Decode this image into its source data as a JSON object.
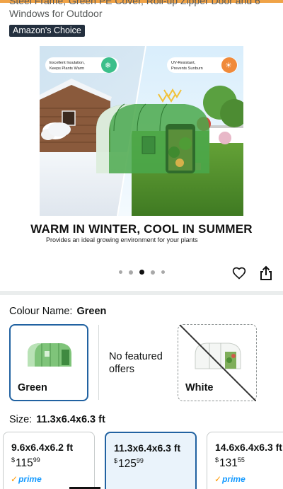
{
  "product": {
    "title_tail": "Steel Frame, Green PE Cover, Roll-up Zipper Door and 6 Windows for Outdoor",
    "badge": "Amazon's Choice"
  },
  "hero": {
    "callout_left": "Excellent Insulation, Keeps Plants Warm",
    "callout_right": "UV-Resistant, Prevents Sunburn",
    "tagline": "WARM IN WINTER, COOL IN SUMMER",
    "subtagline": "Provides an ideal growing environment for your plants"
  },
  "carousel": {
    "count": 5,
    "active_index": 2
  },
  "colour": {
    "label": "Colour Name:",
    "selected": "Green",
    "options": [
      {
        "name": "Green",
        "state": "selected"
      },
      {
        "name": "No featured offers",
        "state": "info"
      },
      {
        "name": "White",
        "state": "unavailable"
      }
    ]
  },
  "size": {
    "label": "Size:",
    "selected": "11.3x6.4x6.3 ft",
    "options": [
      {
        "dim": "9.6x6.4x6.2 ft",
        "currency": "$",
        "whole": "115",
        "fraction": "99",
        "prime": "prime"
      },
      {
        "dim": "11.3x6.4x6.3 ft",
        "currency": "$",
        "whole": "125",
        "fraction": "99",
        "prime": ""
      },
      {
        "dim": "14.6x6.4x6.3 ft",
        "currency": "$",
        "whole": "131",
        "fraction": "55",
        "prime": "prime"
      }
    ]
  },
  "icons": {
    "heart": "heart-icon",
    "share": "share-icon",
    "snowflake": "snowflake-icon",
    "sun": "sun-icon",
    "prime_check": "check-icon"
  },
  "colors": {
    "selected_border": "#2162a1",
    "prime_blue": "#1399ff",
    "badge_bg": "#232f3e",
    "accent_orange": "#f0a347"
  }
}
